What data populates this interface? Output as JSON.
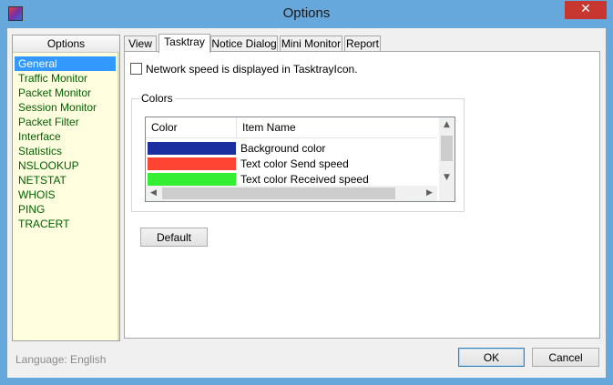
{
  "window": {
    "title": "Options"
  },
  "left": {
    "header": "Options",
    "items": [
      {
        "label": "General"
      },
      {
        "label": "Traffic Monitor"
      },
      {
        "label": "Packet Monitor"
      },
      {
        "label": "Session Monitor"
      },
      {
        "label": "Packet Filter"
      },
      {
        "label": "Interface"
      },
      {
        "label": "Statistics"
      },
      {
        "label": "NSLOOKUP"
      },
      {
        "label": "NETSTAT"
      },
      {
        "label": "WHOIS"
      },
      {
        "label": "PING"
      },
      {
        "label": "TRACERT"
      }
    ],
    "selected": "General"
  },
  "tabs": [
    {
      "label": "View"
    },
    {
      "label": "Tasktray"
    },
    {
      "label": "Notice Dialog"
    },
    {
      "label": "Mini Monitor"
    },
    {
      "label": "Report"
    }
  ],
  "active_tab": "Tasktray",
  "tasktray": {
    "checkbox_label": "Network speed is displayed in TasktrayIcon.",
    "checkbox_checked": false,
    "colors_group": "Colors",
    "columns": {
      "color": "Color",
      "item_name": "Item Name"
    },
    "rows": [
      {
        "color": "#1b2fa0",
        "name": "Background color"
      },
      {
        "color": "#ff4433",
        "name": "Text color Send speed"
      },
      {
        "color": "#33ee33",
        "name": "Text color Received speed"
      }
    ],
    "default_button": "Default"
  },
  "footer": {
    "language": "Language: English",
    "ok": "OK",
    "cancel": "Cancel"
  },
  "icons": {
    "close": "close-icon",
    "app": "app-icon"
  }
}
